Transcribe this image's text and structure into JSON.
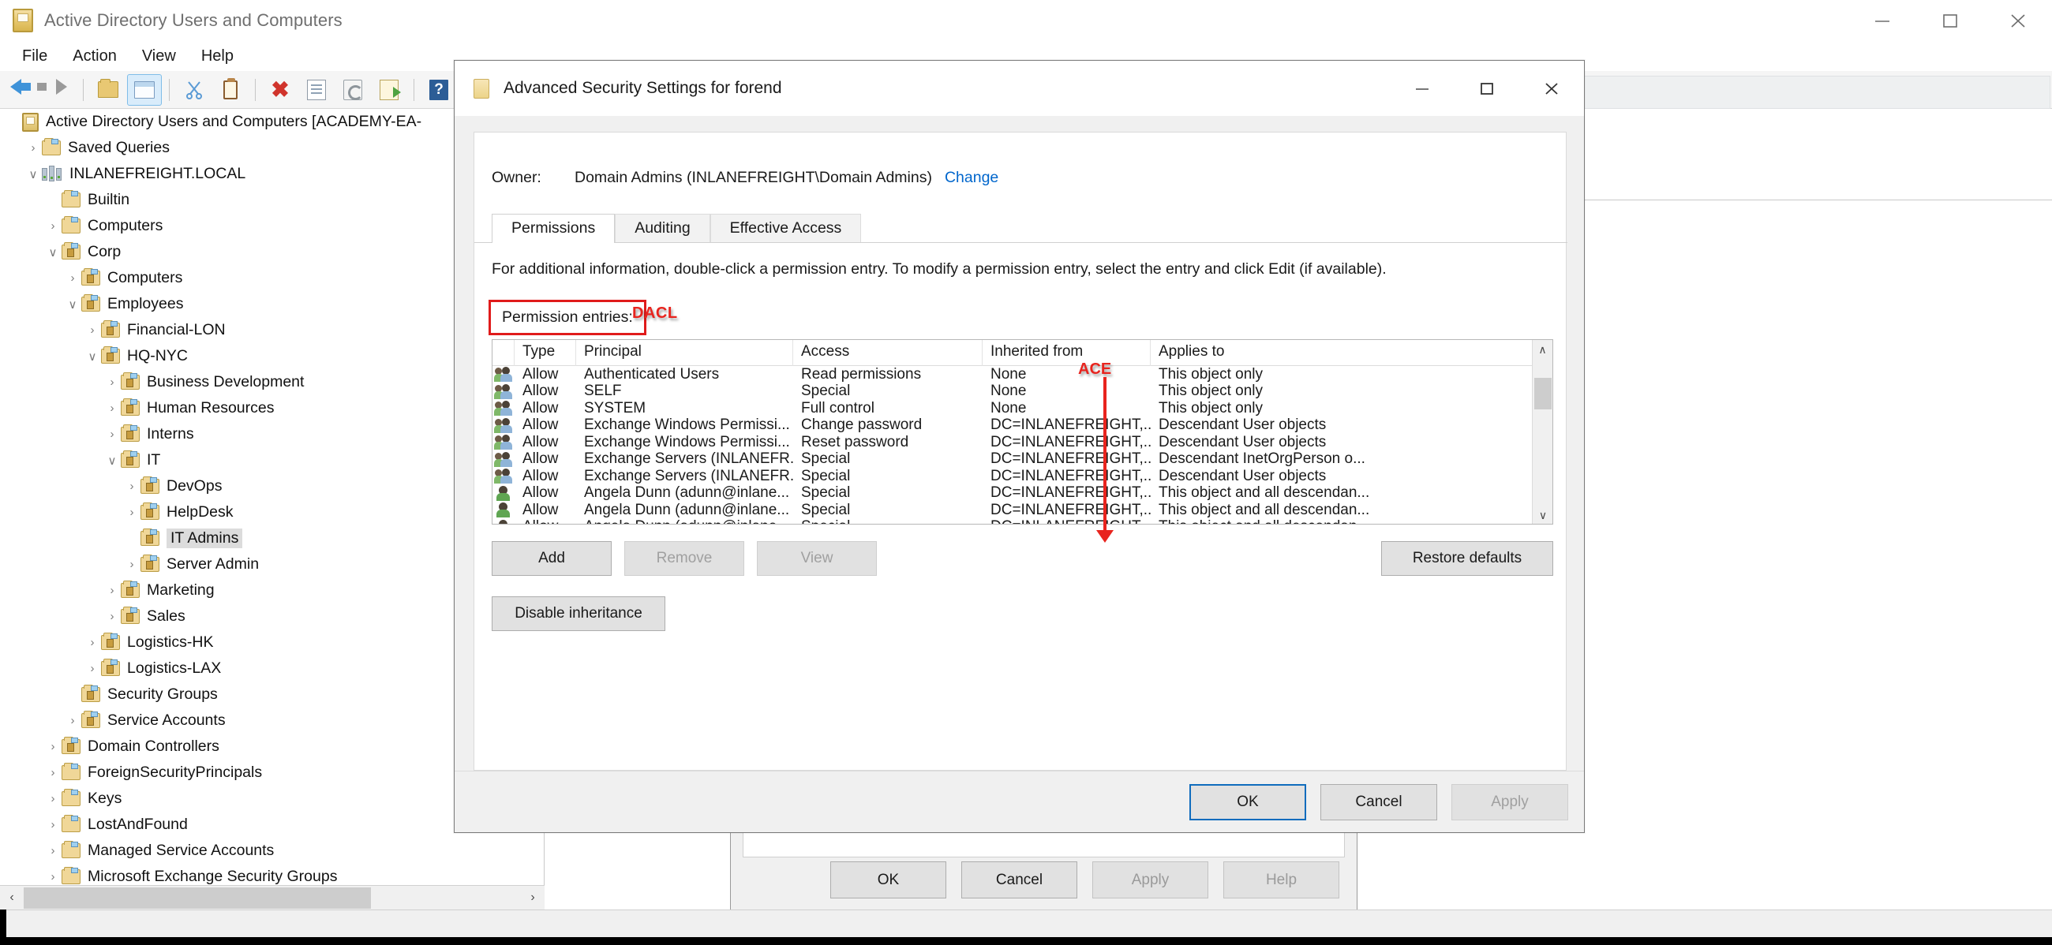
{
  "main_window": {
    "title": "Active Directory Users and Computers",
    "title_icon": "console-icon",
    "controls": {
      "minimize": "minimize-icon",
      "maximize": "maximize-icon",
      "close": "close-icon"
    },
    "menu": [
      "File",
      "Action",
      "View",
      "Help"
    ],
    "toolbar_icons": [
      "back-arrow-icon",
      "forward-arrow-icon",
      "up-folder-icon",
      "show-hide-console-tree-icon",
      "cut-icon",
      "paste-icon",
      "delete-icon",
      "properties-icon",
      "refresh-icon",
      "export-list-icon",
      "help-icon",
      "run-icon"
    ],
    "tree": [
      {
        "label": "Active Directory Users and Computers [ACADEMY-EA-",
        "indent": 0,
        "twisty": "",
        "icon": "console-root-icon",
        "selected": false
      },
      {
        "label": "Saved Queries",
        "indent": 1,
        "twisty": "›",
        "icon": "folder-icon",
        "selected": false
      },
      {
        "label": "INLANEFREIGHT.LOCAL",
        "indent": 1,
        "twisty": "∨",
        "icon": "domain-icon",
        "selected": false
      },
      {
        "label": "Builtin",
        "indent": 2,
        "twisty": "",
        "icon": "folder-icon",
        "selected": false
      },
      {
        "label": "Computers",
        "indent": 2,
        "twisty": "›",
        "icon": "folder-icon",
        "selected": false
      },
      {
        "label": "Corp",
        "indent": 2,
        "twisty": "∨",
        "icon": "ou-icon",
        "selected": false
      },
      {
        "label": "Computers",
        "indent": 3,
        "twisty": "›",
        "icon": "ou-icon",
        "selected": false
      },
      {
        "label": "Employees",
        "indent": 3,
        "twisty": "∨",
        "icon": "ou-icon",
        "selected": false
      },
      {
        "label": "Financial-LON",
        "indent": 4,
        "twisty": "›",
        "icon": "ou-icon",
        "selected": false
      },
      {
        "label": "HQ-NYC",
        "indent": 4,
        "twisty": "∨",
        "icon": "ou-icon",
        "selected": false
      },
      {
        "label": "Business Development",
        "indent": 5,
        "twisty": "›",
        "icon": "ou-icon",
        "selected": false
      },
      {
        "label": "Human Resources",
        "indent": 5,
        "twisty": "›",
        "icon": "ou-icon",
        "selected": false
      },
      {
        "label": "Interns",
        "indent": 5,
        "twisty": "›",
        "icon": "ou-icon",
        "selected": false
      },
      {
        "label": "IT",
        "indent": 5,
        "twisty": "∨",
        "icon": "ou-icon",
        "selected": false
      },
      {
        "label": "DevOps",
        "indent": 6,
        "twisty": "›",
        "icon": "ou-icon",
        "selected": false
      },
      {
        "label": "HelpDesk",
        "indent": 6,
        "twisty": "›",
        "icon": "ou-icon",
        "selected": false
      },
      {
        "label": "IT Admins",
        "indent": 6,
        "twisty": "",
        "icon": "ou-icon",
        "selected": true
      },
      {
        "label": "Server Admin",
        "indent": 6,
        "twisty": "›",
        "icon": "ou-icon",
        "selected": false
      },
      {
        "label": "Marketing",
        "indent": 5,
        "twisty": "›",
        "icon": "ou-icon",
        "selected": false
      },
      {
        "label": "Sales",
        "indent": 5,
        "twisty": "›",
        "icon": "ou-icon",
        "selected": false
      },
      {
        "label": "Logistics-HK",
        "indent": 4,
        "twisty": "›",
        "icon": "ou-icon",
        "selected": false
      },
      {
        "label": "Logistics-LAX",
        "indent": 4,
        "twisty": "›",
        "icon": "ou-icon",
        "selected": false
      },
      {
        "label": "Security Groups",
        "indent": 3,
        "twisty": "",
        "icon": "ou-icon",
        "selected": false
      },
      {
        "label": "Service Accounts",
        "indent": 3,
        "twisty": "›",
        "icon": "ou-icon",
        "selected": false
      },
      {
        "label": "Domain Controllers",
        "indent": 2,
        "twisty": "›",
        "icon": "ou-icon",
        "selected": false
      },
      {
        "label": "ForeignSecurityPrincipals",
        "indent": 2,
        "twisty": "›",
        "icon": "folder-icon",
        "selected": false
      },
      {
        "label": "Keys",
        "indent": 2,
        "twisty": "›",
        "icon": "folder-icon",
        "selected": false
      },
      {
        "label": "LostAndFound",
        "indent": 2,
        "twisty": "›",
        "icon": "folder-icon",
        "selected": false
      },
      {
        "label": "Managed Service Accounts",
        "indent": 2,
        "twisty": "›",
        "icon": "folder-icon",
        "selected": false
      },
      {
        "label": "Microsoft Exchange Security Groups",
        "indent": 2,
        "twisty": "›",
        "icon": "folder-icon",
        "selected": false
      }
    ],
    "scroll": {
      "left_arrow": "‹",
      "right_arrow": "›",
      "down_arrow": "∨"
    }
  },
  "properties_dialog": {
    "buttons": [
      {
        "label": "OK",
        "state": "enabled"
      },
      {
        "label": "Cancel",
        "state": "enabled"
      },
      {
        "label": "Apply",
        "state": "disabled"
      },
      {
        "label": "Help",
        "state": "disabled"
      }
    ]
  },
  "advanced_dialog": {
    "title": "Advanced Security Settings for forend",
    "title_icon": "folder-icon",
    "controls": {
      "minimize": "minimize-icon",
      "maximize": "maximize-icon",
      "close": "close-icon"
    },
    "owner": {
      "label": "Owner:",
      "value": "Domain Admins (INLANEFREIGHT\\Domain Admins)",
      "change_link": "Change"
    },
    "tabs": [
      {
        "label": "Permissions",
        "active": true
      },
      {
        "label": "Auditing",
        "active": false
      },
      {
        "label": "Effective Access",
        "active": false
      }
    ],
    "info_text": "For additional information, double-click a permission entry. To modify a permission entry, select the entry and click Edit (if available).",
    "permission_entries_label": "Permission entries:",
    "annotations": {
      "dacl": "DACL",
      "ace": "ACE"
    },
    "grid": {
      "columns": [
        "Type",
        "Principal",
        "Access",
        "Inherited from",
        "Applies to"
      ],
      "rows": [
        {
          "icon": "users-group-icon",
          "type": "Allow",
          "principal": "Authenticated Users",
          "access": "Read permissions",
          "inherited": "None",
          "applies": "This object only"
        },
        {
          "icon": "users-group-icon",
          "type": "Allow",
          "principal": "SELF",
          "access": "Special",
          "inherited": "None",
          "applies": "This object only"
        },
        {
          "icon": "users-group-icon",
          "type": "Allow",
          "principal": "SYSTEM",
          "access": "Full control",
          "inherited": "None",
          "applies": "This object only"
        },
        {
          "icon": "users-group-icon",
          "type": "Allow",
          "principal": "Exchange Windows Permissi...",
          "access": "Change password",
          "inherited": "DC=INLANEFREIGHT,...",
          "applies": "Descendant User objects"
        },
        {
          "icon": "users-group-icon",
          "type": "Allow",
          "principal": "Exchange Windows Permissi...",
          "access": "Reset password",
          "inherited": "DC=INLANEFREIGHT,...",
          "applies": "Descendant User objects"
        },
        {
          "icon": "users-group-icon",
          "type": "Allow",
          "principal": "Exchange Servers (INLANEFR...",
          "access": "Special",
          "inherited": "DC=INLANEFREIGHT,...",
          "applies": "Descendant InetOrgPerson o..."
        },
        {
          "icon": "users-group-icon",
          "type": "Allow",
          "principal": "Exchange Servers (INLANEFR...",
          "access": "Special",
          "inherited": "DC=INLANEFREIGHT,...",
          "applies": "Descendant User objects"
        },
        {
          "icon": "user-icon",
          "type": "Allow",
          "principal": "Angela Dunn (adunn@inlane...",
          "access": "Special",
          "inherited": "DC=INLANEFREIGHT,...",
          "applies": "This object and all descendan..."
        },
        {
          "icon": "user-icon",
          "type": "Allow",
          "principal": "Angela Dunn (adunn@inlane...",
          "access": "Special",
          "inherited": "DC=INLANEFREIGHT,...",
          "applies": "This object and all descendan..."
        },
        {
          "icon": "user-icon",
          "type": "Allow",
          "principal": "Angela Dunn (adunn@inlane...",
          "access": "Special",
          "inherited": "DC=INLANEFREIGHT,...",
          "applies": "This object and all descendan..."
        }
      ],
      "scrollbar": {
        "up_arrow": "∧",
        "down_arrow": "∨"
      }
    },
    "action_buttons": [
      {
        "label": "Add",
        "state": "enabled"
      },
      {
        "label": "Remove",
        "state": "disabled"
      },
      {
        "label": "View",
        "state": "disabled"
      },
      {
        "label": "Restore defaults",
        "state": "enabled"
      }
    ],
    "inheritance_button": {
      "label": "Disable inheritance",
      "state": "enabled"
    },
    "footer_buttons": [
      {
        "label": "OK",
        "state": "default"
      },
      {
        "label": "Cancel",
        "state": "enabled"
      },
      {
        "label": "Apply",
        "state": "disabled"
      }
    ]
  },
  "colors": {
    "accent_link": "#0066cc",
    "annotation_red": "#e8241e",
    "selection_gray": "#dcdcdc",
    "default_button_border": "#0f6cbd"
  }
}
